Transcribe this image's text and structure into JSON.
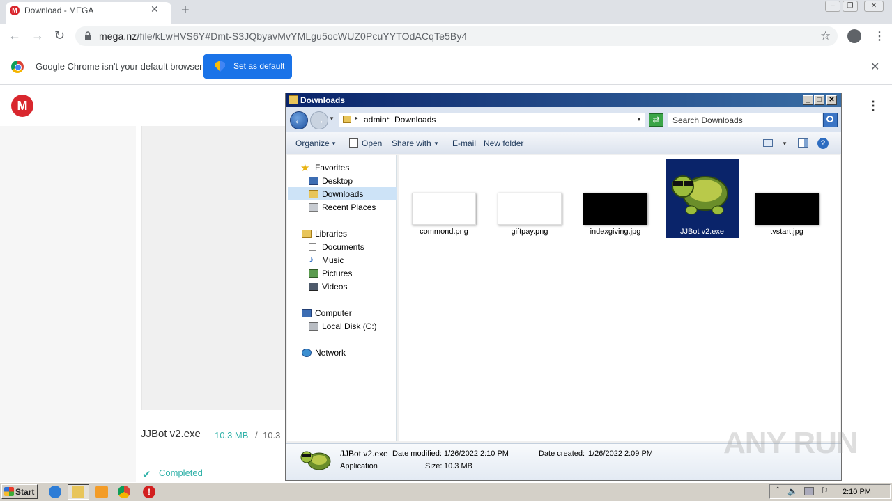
{
  "browser": {
    "tab_title": "Download - MEGA",
    "url_host": "mega.nz",
    "url_path": "/file/kLwHVS6Y#Dmt-S3JQbyavMvYMLgu5ocWUZ0PcuYYTOdACqTe5By4",
    "infobar_text": "Google Chrome isn't your default browser",
    "set_default_label": "Set as default"
  },
  "mega": {
    "file_name": "JJBot v2.exe",
    "downloaded": "10.3 MB",
    "slash": "/",
    "total": "10.3",
    "status": "Completed"
  },
  "explorer": {
    "title": "Downloads",
    "breadcrumb": [
      "admin",
      "Downloads"
    ],
    "search_placeholder": "Search Downloads",
    "commands": [
      "Organize",
      "Open",
      "Share with",
      "E-mail",
      "New folder"
    ],
    "nav": {
      "favorites": "Favorites",
      "desktop": "Desktop",
      "downloads": "Downloads",
      "recent": "Recent Places",
      "libraries": "Libraries",
      "documents": "Documents",
      "music": "Music",
      "pictures": "Pictures",
      "videos": "Videos",
      "computer": "Computer",
      "local_disk": "Local Disk (C:)",
      "network": "Network"
    },
    "files": [
      {
        "name": "commond.png"
      },
      {
        "name": "giftpay.png"
      },
      {
        "name": "indexgiving.jpg"
      },
      {
        "name": "JJBot v2.exe"
      },
      {
        "name": "tvstart.jpg"
      }
    ],
    "details": {
      "name": "JJBot v2.exe",
      "type": "Application",
      "modified_label": "Date modified:",
      "modified": "1/26/2022 2:10 PM",
      "created_label": "Date created:",
      "created": "1/26/2022 2:09 PM",
      "size_label": "Size:",
      "size": "10.3 MB"
    }
  },
  "taskbar": {
    "start": "Start",
    "clock": "2:10 PM"
  },
  "watermark": "ANY RUN",
  "colors": {
    "mega_red": "#d9272e",
    "chrome_blue": "#1a73e8",
    "mega_teal": "#31b2a9",
    "selection": "#0a246a"
  }
}
